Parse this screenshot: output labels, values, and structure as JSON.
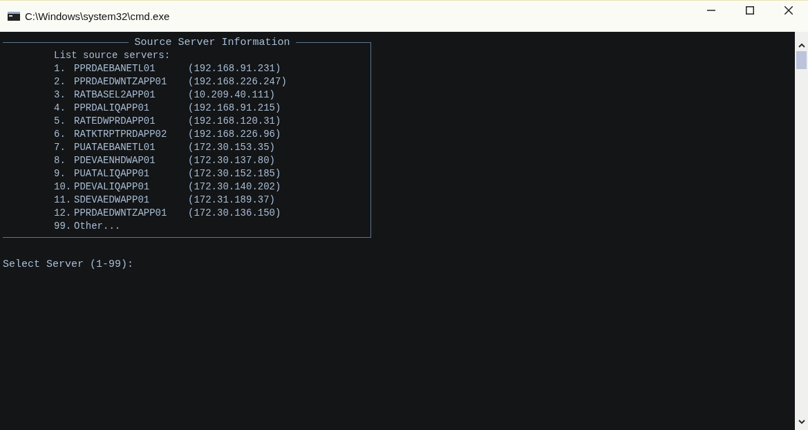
{
  "window": {
    "title": "C:\\Windows\\system32\\cmd.exe"
  },
  "console": {
    "box_title": "Source Server Information",
    "list_heading": "List source servers:",
    "servers": [
      {
        "number": "1.",
        "name": "PPRDAEBANETL01",
        "ip": "(192.168.91.231)"
      },
      {
        "number": "2.",
        "name": "PPRDAEDWNTZAPP01",
        "ip": "(192.168.226.247)"
      },
      {
        "number": "3.",
        "name": "RATBASEL2APP01",
        "ip": "(10.209.40.111)"
      },
      {
        "number": "4.",
        "name": "PPRDALIQAPP01",
        "ip": "(192.168.91.215)"
      },
      {
        "number": "5.",
        "name": "RATEDWPRDAPP01",
        "ip": "(192.168.120.31)"
      },
      {
        "number": "6.",
        "name": "RATKTRPTPRDAPP02",
        "ip": "(192.168.226.96)"
      },
      {
        "number": "7.",
        "name": "PUATAEBANETL01",
        "ip": "(172.30.153.35)"
      },
      {
        "number": "8.",
        "name": "PDEVAENHDWAP01",
        "ip": "(172.30.137.80)"
      },
      {
        "number": "9.",
        "name": "PUATALIQAPP01",
        "ip": "(172.30.152.185)"
      },
      {
        "number": "10.",
        "name": "PDEVALIQAPP01",
        "ip": "(172.30.140.202)"
      },
      {
        "number": "11.",
        "name": "SDEVAEDWAPP01",
        "ip": "(172.31.189.37)"
      },
      {
        "number": "12.",
        "name": "PPRDAEDWNTZAPP01",
        "ip": "(172.30.136.150)"
      }
    ],
    "other": {
      "number": "99.",
      "label": "Other..."
    },
    "prompt": "Select Server (1-99):"
  }
}
